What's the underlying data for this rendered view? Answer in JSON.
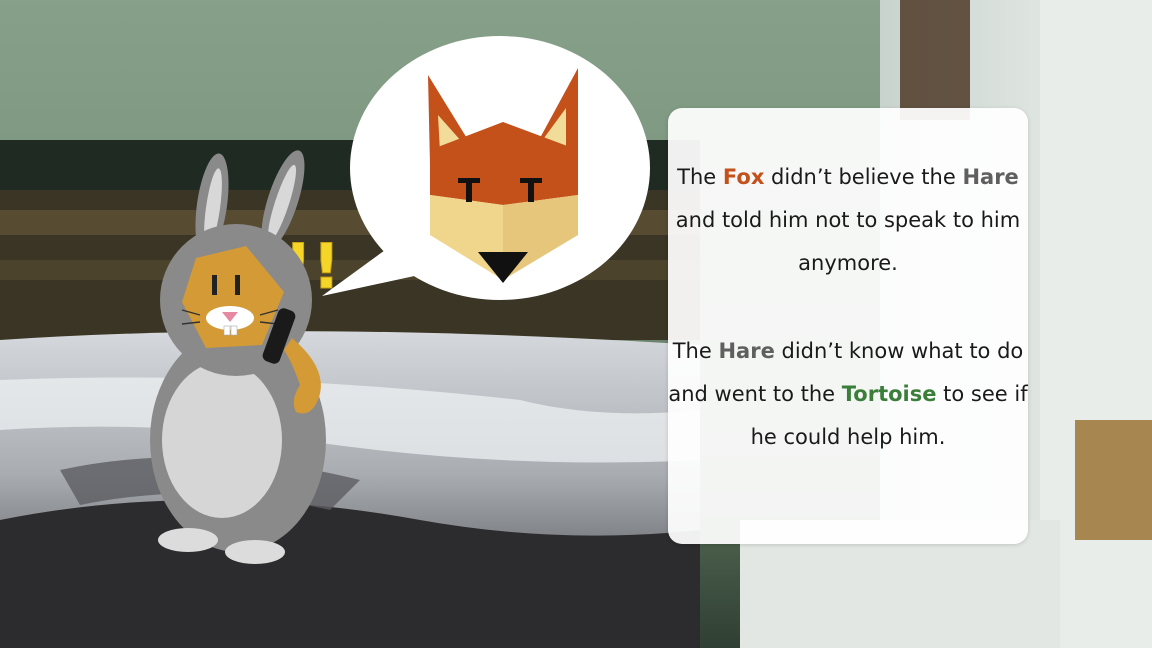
{
  "colors": {
    "fox": "#c4501a",
    "hare": "#5f5f5f",
    "tortoise": "#3a7e3a",
    "exclaim": "#f4d528",
    "panel": "#ffffff"
  },
  "icons": {
    "fox": "fox-head-icon",
    "hare": "hare-character",
    "exclamation": "double-exclamation-icon"
  },
  "exclamation": "!!",
  "story": {
    "para1": {
      "fox_name": "Fox",
      "after_fox": " didn’t believe the ",
      "hare_name": "Hare",
      "after_hare": " and told him not to speak to him anymore."
    },
    "para2": {
      "before": "The ",
      "hare_name": "Hare",
      "after_hare": " didn’t know what to do and went to the ",
      "tortoise_name": "Tortoise",
      "after_tortoise": " to see if he could help him."
    },
    "para1_lead": "The "
  }
}
